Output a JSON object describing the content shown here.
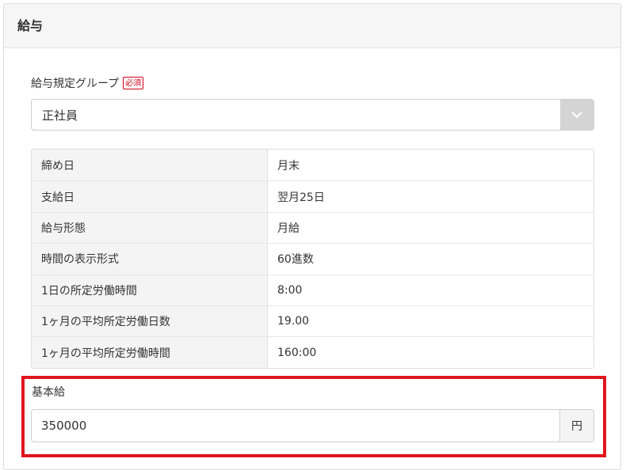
{
  "panel": {
    "title": "給与"
  },
  "salary_group": {
    "label": "給与規定グループ",
    "required_badge": "必須",
    "selected": "正社員"
  },
  "info_rows": [
    {
      "key": "締め日",
      "value": "月末"
    },
    {
      "key": "支給日",
      "value": "翌月25日"
    },
    {
      "key": "給与形態",
      "value": "月給"
    },
    {
      "key": "時間の表示形式",
      "value": "60進数"
    },
    {
      "key": "1日の所定労働時間",
      "value": "8:00"
    },
    {
      "key": "1ヶ月の平均所定労働日数",
      "value": "19.00"
    },
    {
      "key": "1ヶ月の平均所定労働時間",
      "value": "160:00"
    }
  ],
  "base_salary": {
    "label": "基本給",
    "value": "350000",
    "unit": "円"
  },
  "colors": {
    "highlight": "#e0161e",
    "required": "#d0021b"
  }
}
